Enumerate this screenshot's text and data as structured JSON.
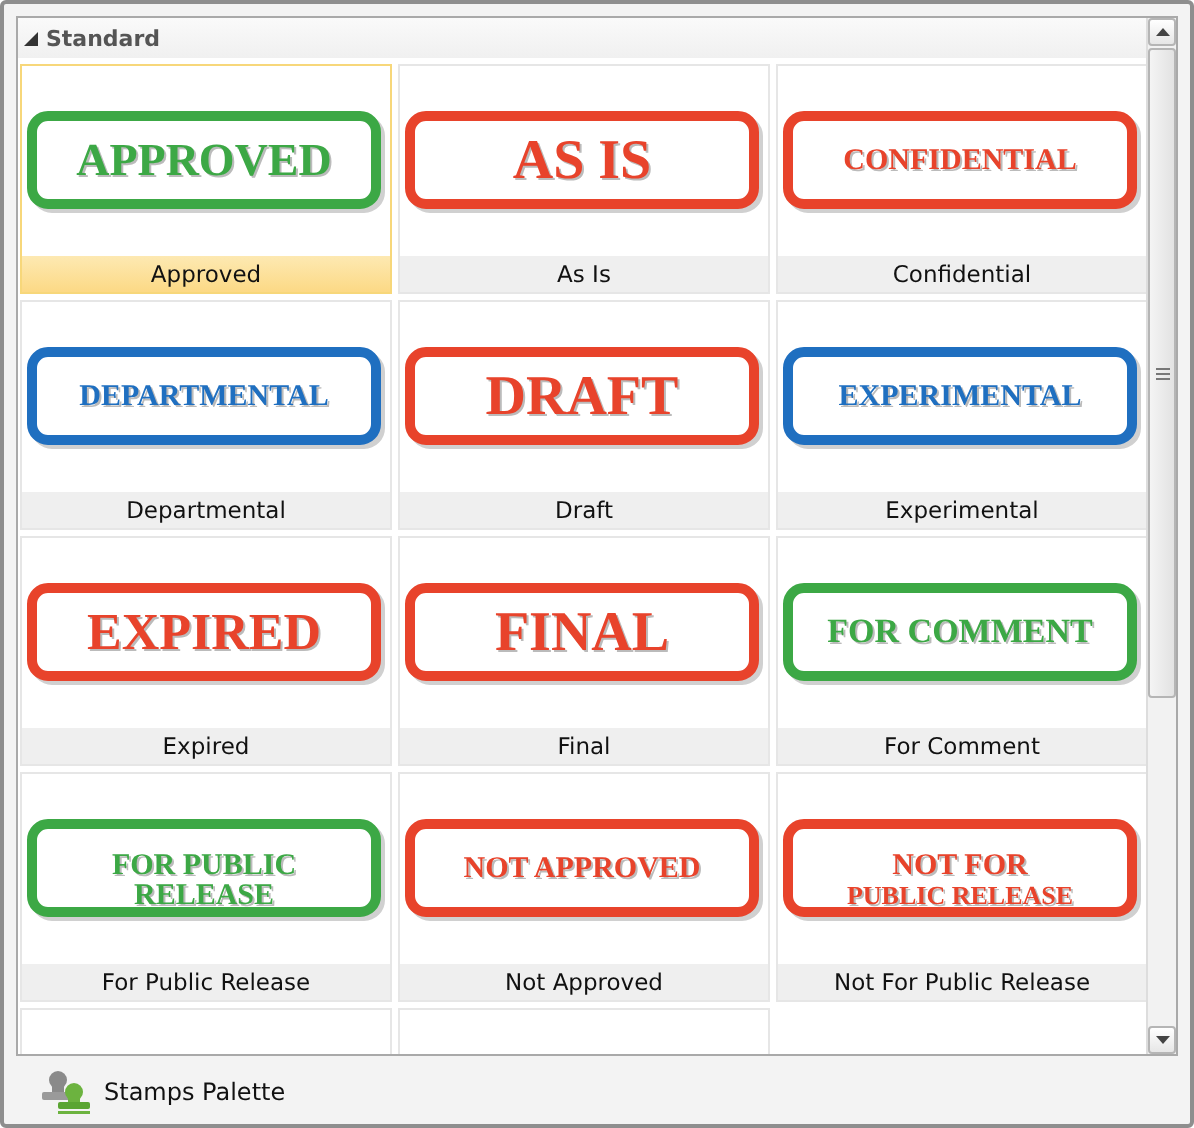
{
  "section": {
    "title": "Standard",
    "expanded": true
  },
  "stamps": [
    {
      "kind": "stamp",
      "label": "Approved",
      "stamp_text": [
        "APPROVED"
      ],
      "color": "#3ca845",
      "selected": true
    },
    {
      "kind": "stamp",
      "label": "As Is",
      "stamp_text": [
        "AS IS"
      ],
      "color": "#e8432b",
      "selected": false
    },
    {
      "kind": "stamp",
      "label": "Confidential",
      "stamp_text": [
        "CONFIDENTIAL"
      ],
      "color": "#e8432b",
      "selected": false
    },
    {
      "kind": "stamp",
      "label": "Departmental",
      "stamp_text": [
        "DEPARTMENTAL"
      ],
      "color": "#1f6fc0",
      "selected": false
    },
    {
      "kind": "stamp",
      "label": "Draft",
      "stamp_text": [
        "DRAFT"
      ],
      "color": "#e8432b",
      "selected": false
    },
    {
      "kind": "stamp",
      "label": "Experimental",
      "stamp_text": [
        "EXPERIMENTAL"
      ],
      "color": "#1f6fc0",
      "selected": false
    },
    {
      "kind": "stamp",
      "label": "Expired",
      "stamp_text": [
        "EXPIRED"
      ],
      "color": "#e8432b",
      "selected": false
    },
    {
      "kind": "stamp",
      "label": "Final",
      "stamp_text": [
        "FINAL"
      ],
      "color": "#e8432b",
      "selected": false
    },
    {
      "kind": "stamp",
      "label": "For Comment",
      "stamp_text": [
        "FOR COMMENT"
      ],
      "color": "#3ca845",
      "selected": false
    },
    {
      "kind": "stamp",
      "label": "For Public Release",
      "stamp_text": [
        "FOR PUBLIC",
        "RELEASE"
      ],
      "color": "#3ca845",
      "selected": false
    },
    {
      "kind": "stamp",
      "label": "Not Approved",
      "stamp_text": [
        "NOT APPROVED"
      ],
      "color": "#e8432b",
      "selected": false
    },
    {
      "kind": "stamp",
      "label": "Not For Public Release",
      "stamp_text": [
        "NOT FOR",
        "PUBLIC RELEASE"
      ],
      "color": "#e8432b",
      "selected": false
    },
    {
      "kind": "cut",
      "selected": false
    },
    {
      "kind": "cut",
      "selected": false
    }
  ],
  "footer": {
    "title": "Stamps Palette"
  }
}
